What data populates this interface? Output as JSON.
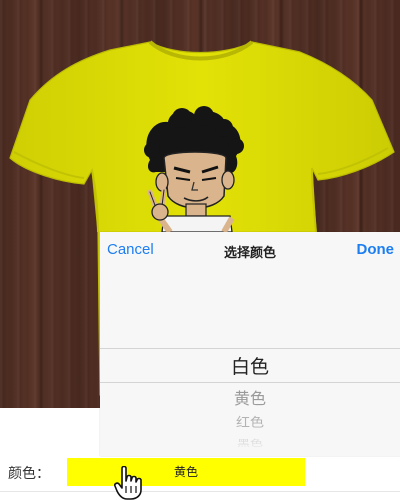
{
  "preview": {
    "shirt_color": "#dede05",
    "background_color": "#4e2d22"
  },
  "picker": {
    "cancel_label": "Cancel",
    "title": "选择颜色",
    "done_label": "Done",
    "options": [
      "白色",
      "黄色",
      "红色",
      "黑色"
    ],
    "selected_index": 0
  },
  "form": {
    "color_label": "颜色：",
    "color_value": "黄色",
    "color_value_background": "#ffff00"
  },
  "icons": {
    "cursor": "hand-pointer-icon"
  }
}
